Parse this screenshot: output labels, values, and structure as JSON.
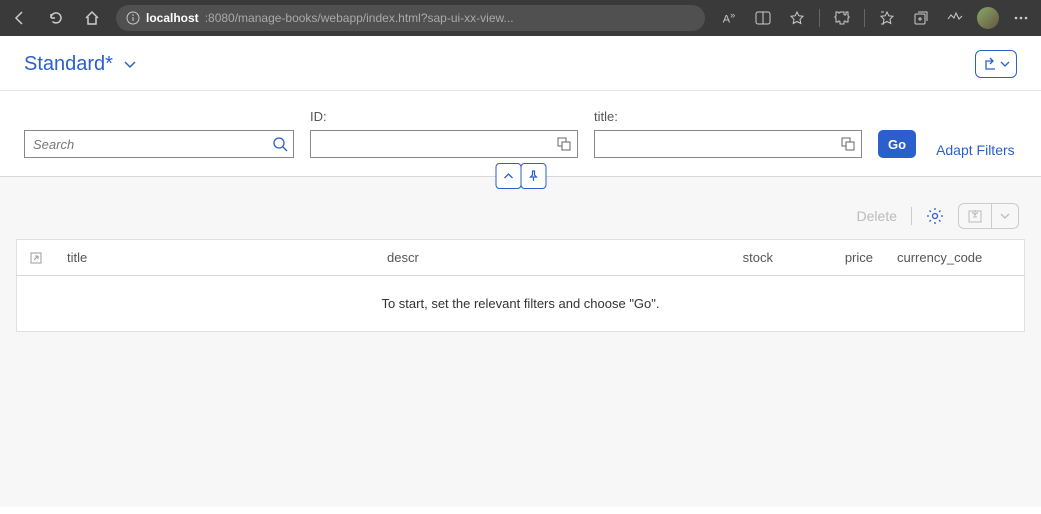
{
  "browser": {
    "url_host": "localhost",
    "url_rest": ":8080/manage-books/webapp/index.html?sap-ui-xx-view..."
  },
  "header": {
    "variant_title": "Standard*"
  },
  "filters": {
    "search_placeholder": "Search",
    "id_label": "ID:",
    "title_label": "title:",
    "go_label": "Go",
    "adapt_label": "Adapt Filters"
  },
  "toolbar": {
    "delete_label": "Delete"
  },
  "table": {
    "columns": {
      "title": "title",
      "descr": "descr",
      "stock": "stock",
      "price": "price",
      "currency_code": "currency_code"
    },
    "empty_text": "To start, set the relevant filters and choose \"Go\"."
  }
}
